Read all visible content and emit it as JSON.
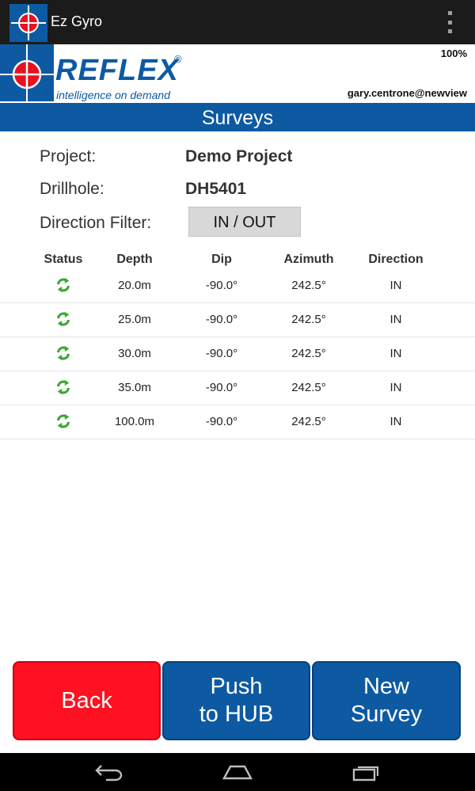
{
  "app": {
    "title": "Ez Gyro"
  },
  "header": {
    "brand": "REFLEX",
    "registered": "®",
    "tagline": "intelligence on demand",
    "battery": "100%",
    "user": "gary.centrone@newview"
  },
  "screen": {
    "title": "Surveys"
  },
  "info": {
    "project_label": "Project:",
    "project_value": "Demo Project",
    "drillhole_label": "Drillhole:",
    "drillhole_value": "DH5401",
    "filter_label": "Direction Filter:",
    "filter_value": "IN / OUT"
  },
  "table": {
    "headers": [
      "Status",
      "Depth",
      "Dip",
      "Azimuth",
      "Direction"
    ],
    "rows": [
      {
        "status_icon": "sync-icon",
        "depth": "20.0m",
        "dip": "-90.0°",
        "azimuth": "242.5°",
        "direction": "IN"
      },
      {
        "status_icon": "sync-icon",
        "depth": "25.0m",
        "dip": "-90.0°",
        "azimuth": "242.5°",
        "direction": "IN"
      },
      {
        "status_icon": "sync-icon",
        "depth": "30.0m",
        "dip": "-90.0°",
        "azimuth": "242.5°",
        "direction": "IN"
      },
      {
        "status_icon": "sync-icon",
        "depth": "35.0m",
        "dip": "-90.0°",
        "azimuth": "242.5°",
        "direction": "IN"
      },
      {
        "status_icon": "sync-icon",
        "depth": "100.0m",
        "dip": "-90.0°",
        "azimuth": "242.5°",
        "direction": "IN"
      }
    ]
  },
  "buttons": {
    "back": "Back",
    "push": "Push\nto HUB",
    "new_survey": "New\nSurvey"
  },
  "colors": {
    "brand_blue": "#0d5aa3",
    "back_red": "#ff1122",
    "sync_green": "#3aa832"
  },
  "nav": {
    "icons": [
      "back-icon",
      "home-icon",
      "recents-icon"
    ]
  }
}
